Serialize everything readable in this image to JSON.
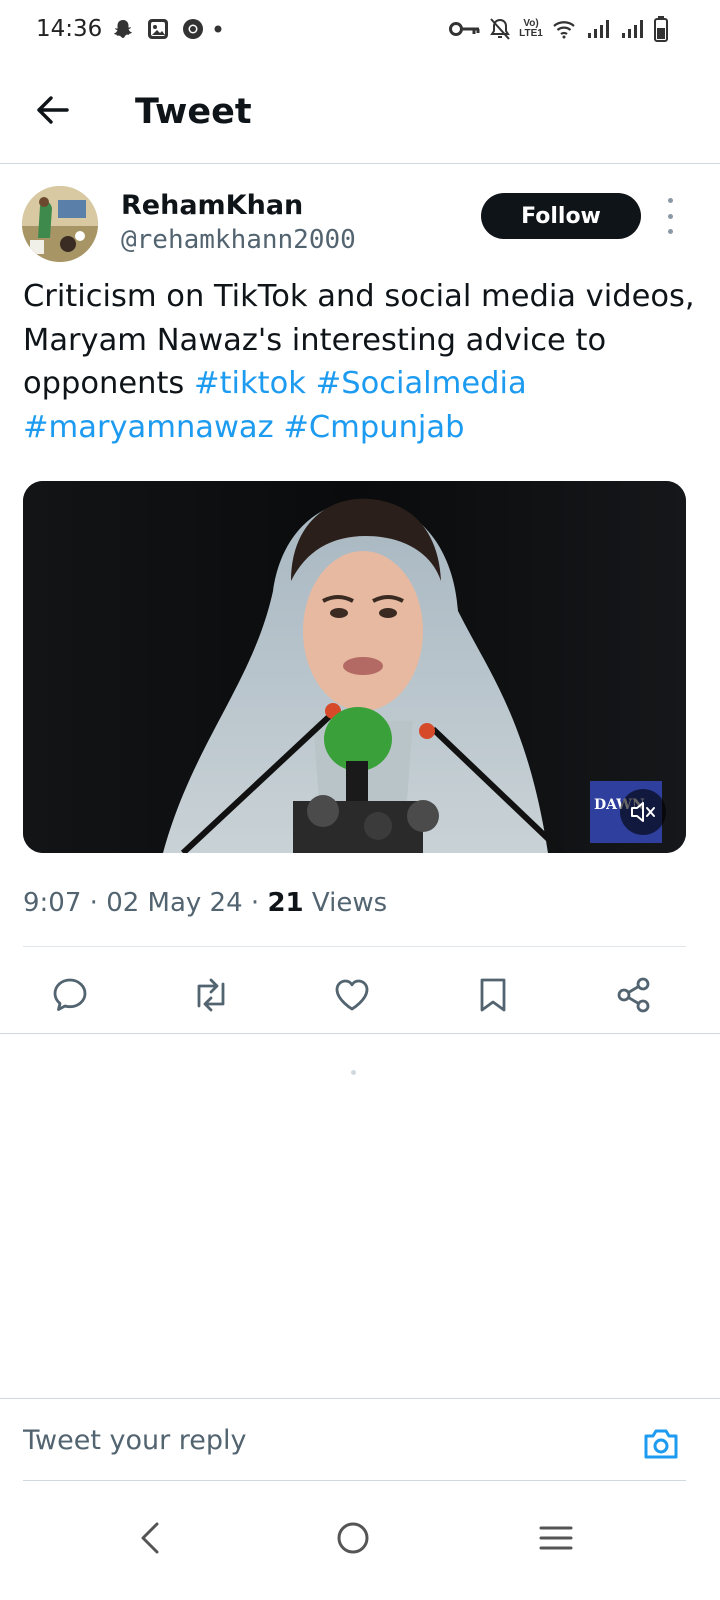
{
  "status_bar": {
    "time": "14:36",
    "left_icons": [
      "snapchat-icon",
      "gallery-icon",
      "chrome-icon",
      "dot-icon"
    ],
    "right_icons": [
      "vpn-key-icon",
      "notifications-off-icon",
      "volte-icon",
      "wifi-icon",
      "signal-icon",
      "signal-icon",
      "battery-icon"
    ],
    "volte_label": "Vo)\nLTE1"
  },
  "header": {
    "title": "Tweet",
    "back_icon": "arrow-left-icon"
  },
  "tweet": {
    "author": {
      "name": "RehamKhan",
      "handle": "@rehamkhann2000"
    },
    "follow_label": "Follow",
    "text_plain": "Criticism on TikTok and social media videos, Maryam Nawaz's interesting advice to opponents ",
    "hashtags": [
      "#tiktok",
      "#Socialmedia",
      "#maryamnawaz",
      "#Cmpunjab"
    ],
    "media": {
      "watermark": "DAWN",
      "mute_icon": "volume-muted-icon"
    },
    "time": "9:07",
    "date": "02 May 24",
    "views_count": "21",
    "views_label": "Views",
    "separator": "·"
  },
  "actions": [
    {
      "name": "reply",
      "icon": "comment-icon"
    },
    {
      "name": "retweet",
      "icon": "retweet-icon"
    },
    {
      "name": "like",
      "icon": "heart-icon"
    },
    {
      "name": "bookmark",
      "icon": "bookmark-icon"
    },
    {
      "name": "share",
      "icon": "share-icon"
    }
  ],
  "reply": {
    "placeholder": "Tweet your reply",
    "camera_icon": "camera-icon"
  },
  "nav": [
    "back-nav-icon",
    "home-nav-icon",
    "recents-nav-icon"
  ],
  "colors": {
    "link": "#1d9bf0",
    "text": "#0f1419",
    "secondary": "#536471",
    "follow_bg": "#0f1419"
  }
}
